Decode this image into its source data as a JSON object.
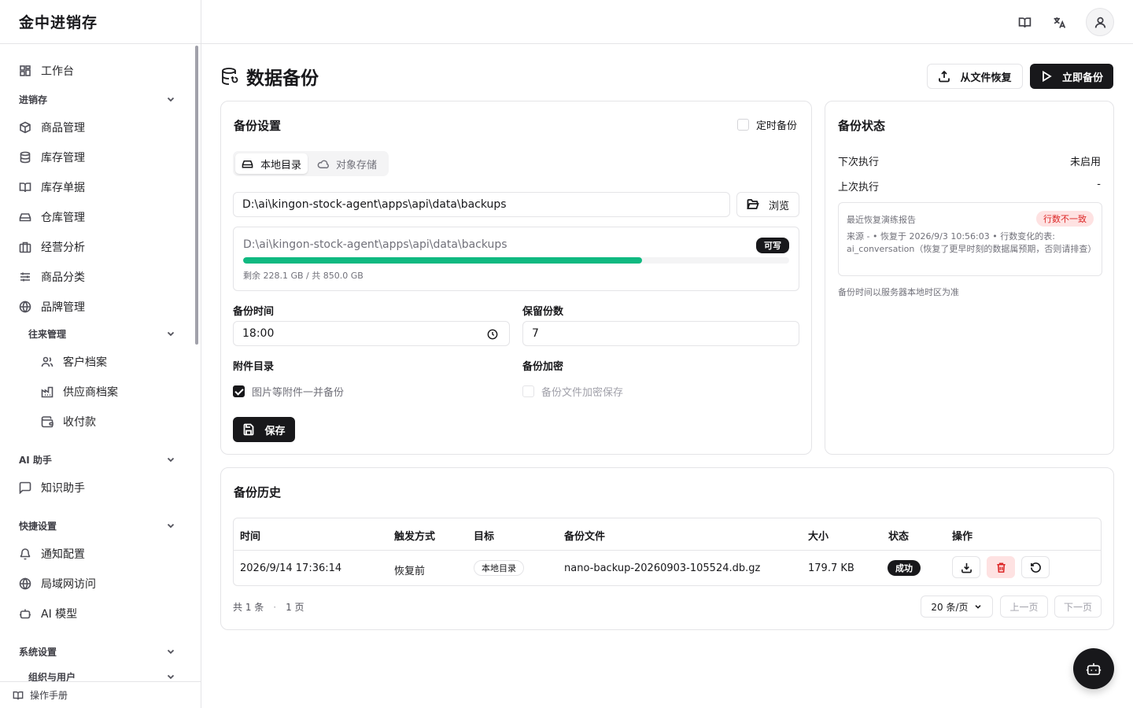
{
  "app": {
    "name": "金中进销存"
  },
  "sidebar": {
    "workbench": "工作台",
    "groups": {
      "inventory": "进销存",
      "contacts": "往来管理",
      "ai": "AI 助手",
      "quick": "快捷设置",
      "system": "系统设置",
      "org": "组织与用户"
    },
    "items": {
      "products": "商品管理",
      "stock": "库存管理",
      "stock_docs": "库存单据",
      "warehouse": "仓库管理",
      "analytics": "经营分析",
      "category": "商品分类",
      "brand": "品牌管理",
      "customers": "客户档案",
      "suppliers": "供应商档案",
      "payments": "收付款",
      "knowledge": "知识助手",
      "notify": "通知配置",
      "lan": "局域网访问",
      "ai_model": "AI 模型"
    },
    "footer": "操作手册"
  },
  "page": {
    "title": "数据备份",
    "restore_button": "从文件恢复",
    "backup_button": "立即备份"
  },
  "settings": {
    "title": "备份设置",
    "scheduled_label": "定时备份",
    "scheduled_checked": false,
    "tabs": [
      "本地目录",
      "对象存储"
    ],
    "active_tab": "本地目录",
    "path_value": "D:\\ai\\kingon-stock-agent\\apps\\api\\data\\backups",
    "browse_button": "浏览",
    "storage": {
      "path": "D:\\ai\\kingon-stock-agent\\apps\\api\\data\\backups",
      "badge": "可写",
      "usage_fraction": 0.731,
      "usage_text": "剩余 228.1 GB / 共 850.0 GB"
    },
    "time_label": "备份时间",
    "time_value": "18:00",
    "keep_label": "保留份数",
    "keep_value": "7",
    "attach_label": "附件目录",
    "attach_option": "图片等附件一并备份",
    "attach_checked": true,
    "encrypt_label": "备份加密",
    "encrypt_option": "备份文件加密保存",
    "encrypt_checked": false,
    "save_button": "保存"
  },
  "status": {
    "title": "备份状态",
    "next_label": "下次执行",
    "next_value": "未启用",
    "last_label": "上次执行",
    "last_value": "-",
    "report_title": "最近恢复演练报告",
    "report_badge": "行数不一致",
    "report_text": "来源 - • 恢复于 2026/9/3 10:56:03 • 行数变化的表: ai_conversation（恢复了更早时刻的数据属预期，否则请排查）",
    "note": "备份时间以服务器本地时区为准"
  },
  "history": {
    "title": "备份历史",
    "columns": [
      "时间",
      "触发方式",
      "目标",
      "备份文件",
      "大小",
      "状态",
      "操作"
    ],
    "rows": [
      {
        "time": "2026/9/14 17:36:14",
        "trigger": "恢复前",
        "target": "本地目录",
        "file": "nano-backup-20260903-105524.db.gz",
        "size": "179.7 KB",
        "status": "成功"
      }
    ],
    "total": "共 1 条",
    "pages": "1 页",
    "page_size": "20 条/页",
    "prev": "上一页",
    "next": "下一页"
  },
  "colors": {
    "accent": "#18181b",
    "progress": "#10b981",
    "danger_bg": "#fee2e2",
    "danger_text": "#dc2626"
  }
}
